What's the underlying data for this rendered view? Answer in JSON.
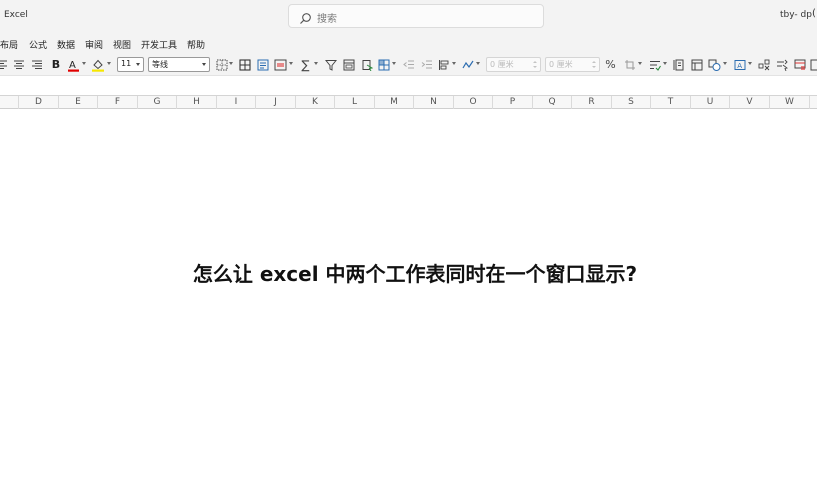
{
  "titlebar": {
    "app_name": "Excel",
    "search_placeholder": "搜索",
    "user_name": "tby- dp",
    "user_extra": "("
  },
  "menu": {
    "items": [
      "布局",
      "公式",
      "数据",
      "审阅",
      "视图",
      "开发工具",
      "帮助"
    ]
  },
  "ribbon": {
    "bold_label": "B",
    "font_color": "#e00000",
    "fill_color": "#f6e700",
    "font_size": "11",
    "font_name": "等线",
    "width_field_value": "0 厘米",
    "height_field_value": "0 厘米",
    "percent_label": "%"
  },
  "columns": [
    "D",
    "E",
    "F",
    "G",
    "H",
    "I",
    "J",
    "K",
    "L",
    "M",
    "N",
    "O",
    "P",
    "Q",
    "R",
    "S",
    "T",
    "U",
    "V",
    "W"
  ],
  "content": {
    "headline": "怎么让 excel 中两个工作表同时在一个窗口显示?"
  }
}
